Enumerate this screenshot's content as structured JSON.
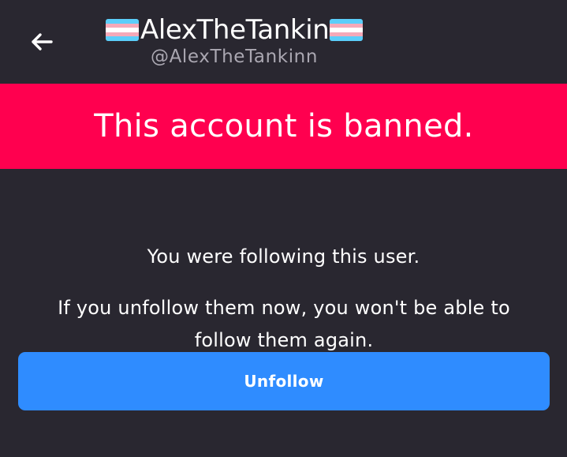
{
  "header": {
    "back_icon": "arrow-left-icon",
    "profile": {
      "display_name": "AlexTheTankin",
      "handle": "@AlexTheTankinn",
      "flag_icon": "transgender-flag-icon"
    }
  },
  "banner": {
    "message": "This account is banned.",
    "background_color": "#ff004f"
  },
  "content": {
    "following_text": "You were following this user.",
    "unfollow_warning": "If you unfollow them now, you won't be able to follow them again."
  },
  "actions": {
    "unfollow_label": "Unfollow",
    "button_color": "#2f8cff"
  },
  "colors": {
    "background": "#292730",
    "text": "#ffffff",
    "secondary_text": "#aaa7b1",
    "flag_blue": "#5bcefa",
    "flag_pink": "#f5a9b8",
    "flag_white": "#ffffff"
  }
}
